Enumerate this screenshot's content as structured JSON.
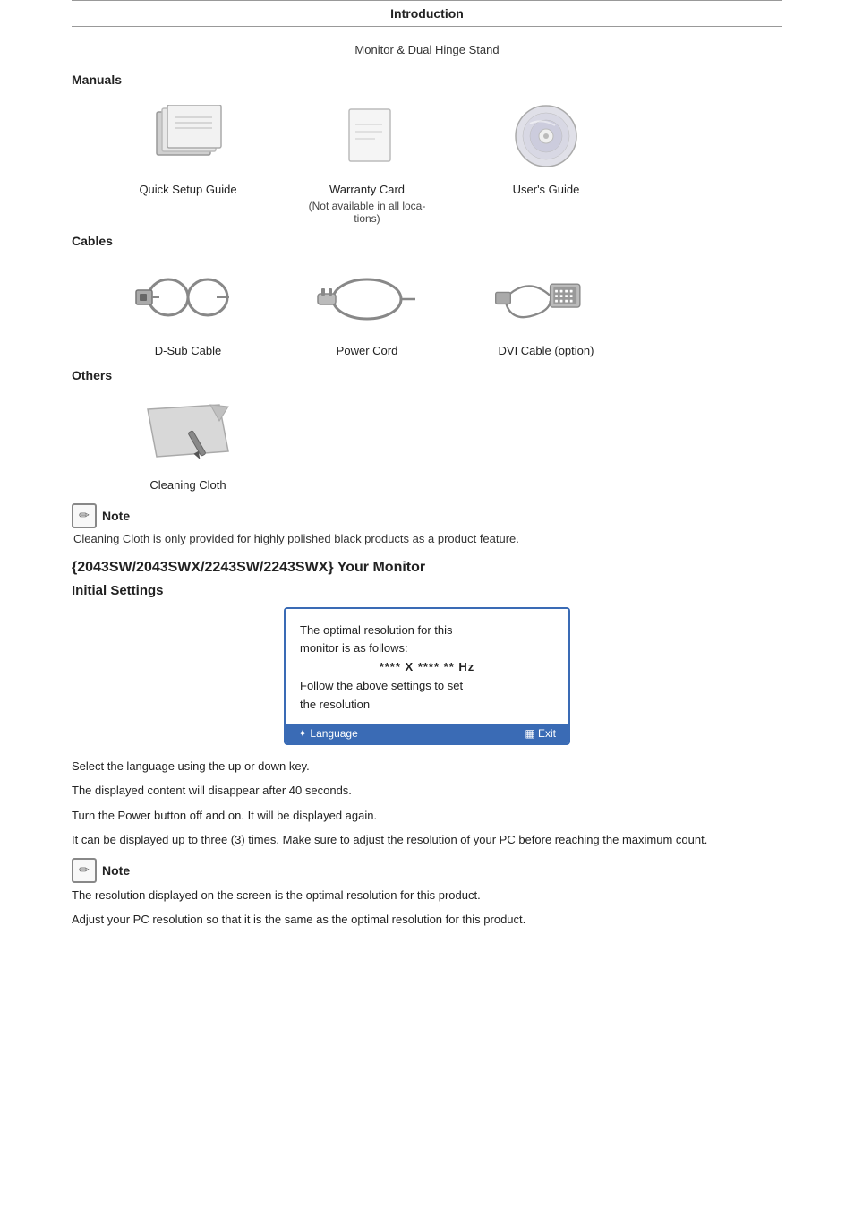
{
  "header": {
    "title": "Introduction"
  },
  "monitor_title": "Monitor & Dual Hinge Stand",
  "sections": {
    "manuals": {
      "label": "Manuals",
      "items": [
        {
          "name": "quick-setup-guide",
          "label": "Quick Setup Guide",
          "sublabel": ""
        },
        {
          "name": "warranty-card",
          "label": "Warranty Card",
          "sublabel": "(Not available in all loca-\ntions)"
        },
        {
          "name": "users-guide",
          "label": "User's Guide",
          "sublabel": ""
        }
      ]
    },
    "cables": {
      "label": "Cables",
      "items": [
        {
          "name": "d-sub-cable",
          "label": "D-Sub Cable",
          "sublabel": ""
        },
        {
          "name": "power-cord",
          "label": "Power Cord",
          "sublabel": ""
        },
        {
          "name": "dvi-cable",
          "label": "DVI Cable (option)",
          "sublabel": ""
        }
      ]
    },
    "others": {
      "label": "Others",
      "items": [
        {
          "name": "cleaning-cloth",
          "label": "Cleaning Cloth",
          "sublabel": ""
        }
      ]
    }
  },
  "note1": {
    "icon_symbol": "✏",
    "label": "Note",
    "text": "Cleaning Cloth is only provided for highly polished black products as a product feature."
  },
  "your_monitor": {
    "heading": "{2043SW/2043SWX/2243SW/2243SWX} Your Monitor"
  },
  "initial_settings": {
    "heading": "Initial Settings",
    "dialog": {
      "line1": "The optimal resolution for this",
      "line2": "monitor is as follows:",
      "line3": "**** X **** ** Hz",
      "line4": "Follow the above settings to set",
      "line5": "the resolution",
      "footer_left": "✦ Language",
      "footer_right": "▦ Exit"
    },
    "instructions": [
      "Select the language using the up or down key.",
      "The displayed content will disappear after 40 seconds.",
      "Turn the Power button off and on. It will be displayed again.",
      "It can be displayed up to three (3) times. Make sure to adjust the resolution of your PC before reaching the maximum count."
    ]
  },
  "note2": {
    "icon_symbol": "✏",
    "label": "Note",
    "texts": [
      "The resolution displayed on the screen is the optimal resolution for this product.",
      "Adjust your PC resolution so that it is the same as the optimal resolution for this product."
    ]
  }
}
